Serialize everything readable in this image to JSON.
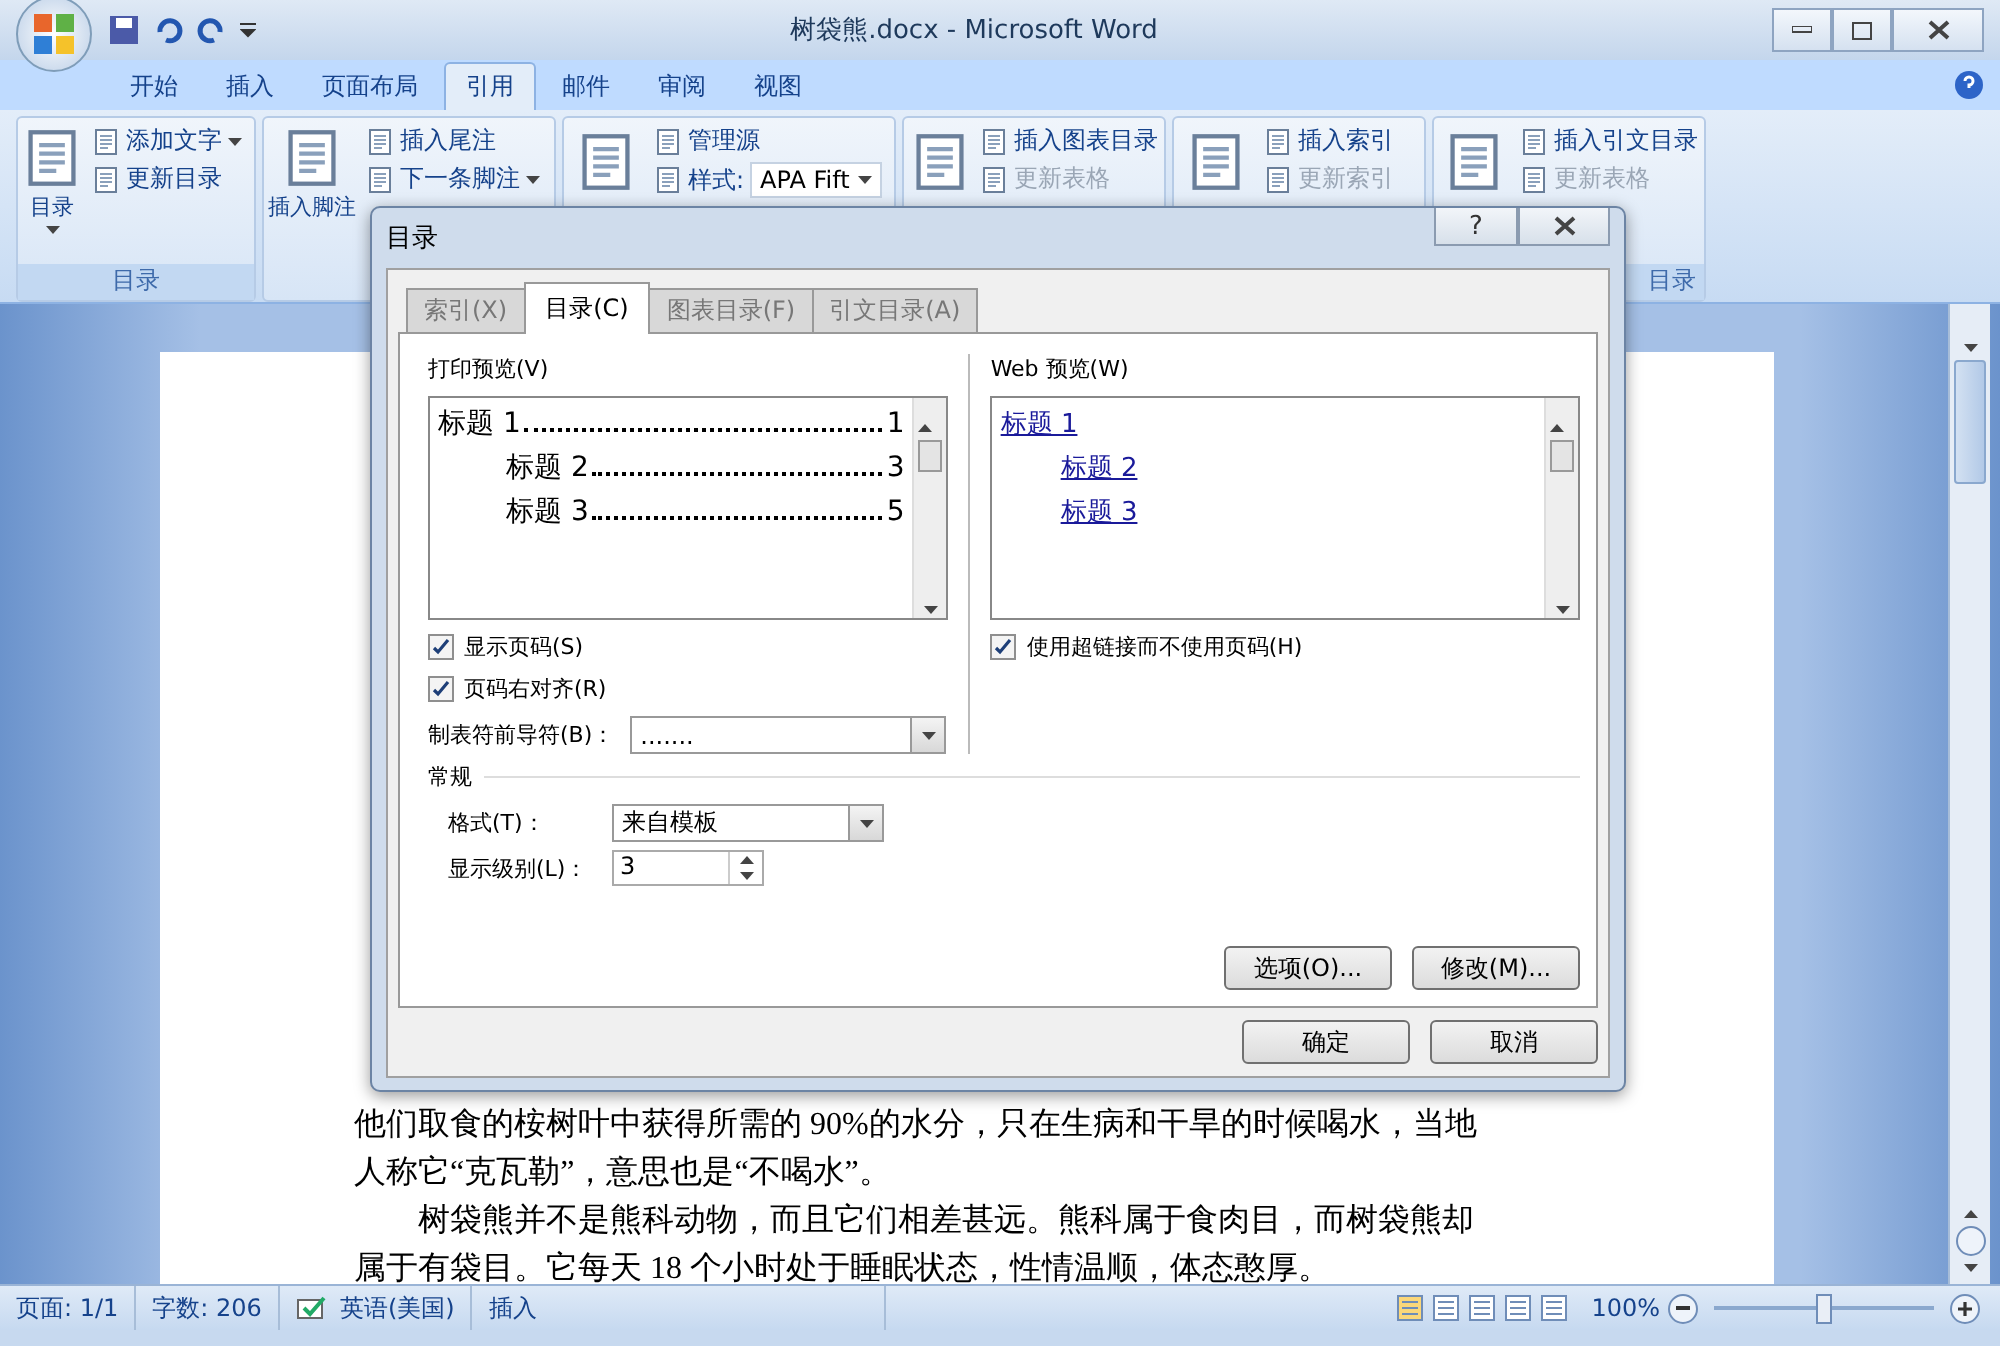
{
  "window": {
    "title": "树袋熊.docx - Microsoft Word"
  },
  "ribbon_tabs": [
    {
      "label": "开始",
      "selected": false
    },
    {
      "label": "插入",
      "selected": false
    },
    {
      "label": "页面布局",
      "selected": false
    },
    {
      "label": "引用",
      "selected": true
    },
    {
      "label": "邮件",
      "selected": false
    },
    {
      "label": "审阅",
      "selected": false
    },
    {
      "label": "视图",
      "selected": false
    }
  ],
  "ribbon_groups": [
    {
      "large": "目录",
      "label": "目录",
      "items": [
        {
          "kind": "button",
          "label": "添加文字",
          "dropdown": true,
          "disabled": false
        },
        {
          "kind": "button",
          "label": "更新目录",
          "dropdown": false,
          "disabled": false
        }
      ]
    },
    {
      "large": "插入脚注",
      "items": [
        {
          "kind": "button",
          "label": "插入尾注",
          "dropdown": false,
          "disabled": false
        },
        {
          "kind": "button",
          "label": "下一条脚注",
          "dropdown": true,
          "disabled": false
        }
      ]
    },
    {
      "items": [
        {
          "kind": "button",
          "label": "管理源",
          "dropdown": false,
          "disabled": false
        },
        {
          "kind": "style",
          "label": "样式:",
          "value": "APA Fift"
        }
      ]
    },
    {
      "items": [
        {
          "kind": "button",
          "label": "插入图表目录",
          "dropdown": false,
          "disabled": false
        },
        {
          "kind": "button",
          "label": "更新表格",
          "dropdown": false,
          "disabled": true
        }
      ]
    },
    {
      "items": [
        {
          "kind": "button",
          "label": "插入索引",
          "dropdown": false,
          "disabled": false
        },
        {
          "kind": "button",
          "label": "更新索引",
          "dropdown": false,
          "disabled": true
        }
      ]
    },
    {
      "label": "目录",
      "items": [
        {
          "kind": "button",
          "label": "插入引文目录",
          "dropdown": false,
          "disabled": false
        },
        {
          "kind": "button",
          "label": "更新表格",
          "dropdown": false,
          "disabled": true
        }
      ]
    }
  ],
  "document": {
    "paragraphs": [
      {
        "indent": false,
        "text": "他们取食的桉树叶中获得所需的 90%的水分，只在生病和干旱的时候喝水，当地人称它“克瓦勒”，意思也是“不喝水”。"
      },
      {
        "indent": true,
        "text": "树袋熊并不是熊科动物，而且它们相差甚远。熊科属于食肉目，而树袋熊却属于有袋目。它每天 18 个小时处于睡眠状态，性情温顺，体态憨厚。"
      }
    ]
  },
  "status_bar": {
    "page": "页面: 1/1",
    "words": "字数: 206",
    "language": "英语(美国)",
    "mode": "插入",
    "zoom": "100%",
    "zoom_level": {
      "level": 0.5
    }
  },
  "dialog": {
    "title": "目录",
    "help": "?",
    "tabs": [
      {
        "label": "索引(X)",
        "selected": false
      },
      {
        "label": "目录(C)",
        "selected": true
      },
      {
        "label": "图表目录(F)",
        "selected": false
      },
      {
        "label": "引文目录(A)",
        "selected": false
      }
    ],
    "print_preview": {
      "label": "打印预览(V)",
      "entries": [
        {
          "title": "标题 1",
          "page": "1",
          "children": [
            {
              "title": "标题 2",
              "page": "3"
            },
            {
              "title": "标题 3",
              "page": "5"
            }
          ]
        }
      ]
    },
    "web_preview": {
      "label": "Web 预览(W)",
      "entries": [
        {
          "title": "标题 1",
          "children": [
            {
              "title": "标题 2"
            },
            {
              "title": "标题 3"
            }
          ]
        }
      ]
    },
    "left_checks": [
      {
        "label": "显示页码(S)",
        "checked": true
      },
      {
        "label": "页码右对齐(R)",
        "checked": true
      }
    ],
    "right_checks": [
      {
        "label": "使用超链接而不使用页码(H)",
        "checked": true
      }
    ],
    "tab_leader": {
      "label": "制表符前导符(B)：",
      "value": "......."
    },
    "general": {
      "title": "常规",
      "format": {
        "label": "格式(T)：",
        "value": "来自模板"
      },
      "levels": {
        "label": "显示级别(L)：",
        "value": "3"
      }
    },
    "buttons": [
      {
        "label": "选项(O)..."
      },
      {
        "label": "修改(M)..."
      }
    ],
    "footer_buttons": [
      {
        "label": "确定"
      },
      {
        "label": "取消"
      }
    ]
  }
}
